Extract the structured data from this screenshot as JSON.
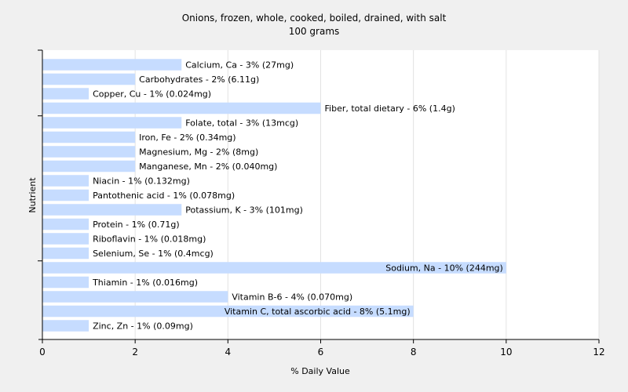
{
  "chart_data": {
    "type": "bar",
    "orientation": "horizontal",
    "title": "Onions, frozen, whole, cooked, boiled, drained, with salt",
    "subtitle": "100 grams",
    "xlabel": "% Daily Value",
    "ylabel": "Nutrient",
    "xlim": [
      0,
      12
    ],
    "xticks": [
      "0",
      "2",
      "4",
      "6",
      "8",
      "10",
      "12"
    ],
    "grid": true,
    "bar_color": "#c6dcff",
    "grid_color": "#e2e2e2",
    "background": "#ffffff",
    "categories": [
      "Calcium, Ca",
      "Carbohydrates",
      "Copper, Cu",
      "Fiber, total dietary",
      "Folate, total",
      "Iron, Fe",
      "Magnesium, Mg",
      "Manganese, Mn",
      "Niacin",
      "Pantothenic acid",
      "Potassium, K",
      "Protein",
      "Riboflavin",
      "Selenium, Se",
      "Sodium, Na",
      "Thiamin",
      "Vitamin B-6",
      "Vitamin C, total ascorbic acid",
      "Zinc, Zn"
    ],
    "values": [
      3,
      2,
      1,
      6,
      3,
      2,
      2,
      2,
      1,
      1,
      3,
      1,
      1,
      1,
      10,
      1,
      4,
      8,
      1
    ],
    "labels": [
      "Calcium, Ca - 3% (27mg)",
      "Carbohydrates - 2% (6.11g)",
      "Copper, Cu - 1% (0.024mg)",
      "Fiber, total dietary - 6% (1.4g)",
      "Folate, total - 3% (13mcg)",
      "Iron, Fe - 2% (0.34mg)",
      "Magnesium, Mg - 2% (8mg)",
      "Manganese, Mn - 2% (0.040mg)",
      "Niacin - 1% (0.132mg)",
      "Pantothenic acid - 1% (0.078mg)",
      "Potassium, K - 3% (101mg)",
      "Protein - 1% (0.71g)",
      "Riboflavin - 1% (0.018mg)",
      "Selenium, Se - 1% (0.4mcg)",
      "Sodium, Na - 10% (244mg)",
      "Thiamin - 1% (0.016mg)",
      "Vitamin B-6 - 4% (0.070mg)",
      "Vitamin C, total ascorbic acid - 8% (5.1mg)",
      "Zinc, Zn - 1% (0.09mg)"
    ]
  }
}
